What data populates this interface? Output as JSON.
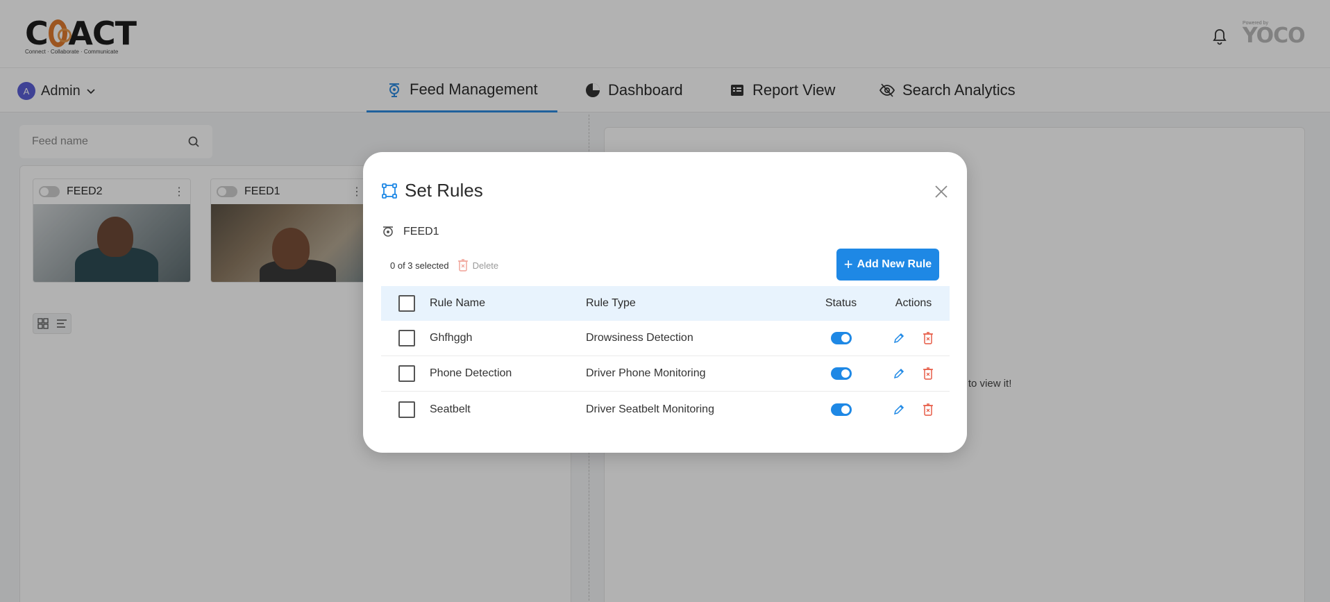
{
  "header": {
    "logo_text_left": "C",
    "logo_text_right": "ACT",
    "logo_tagline": "Connect · Collaborate · Communicate",
    "powered_by": "Powered by",
    "powered_brand": "YOCO"
  },
  "nav": {
    "user_initial": "A",
    "user_name": "Admin",
    "tabs": [
      {
        "label": "Feed Management",
        "icon": "camera-icon",
        "active": true
      },
      {
        "label": "Dashboard",
        "icon": "pie-chart-icon",
        "active": false
      },
      {
        "label": "Report View",
        "icon": "report-icon",
        "active": false
      },
      {
        "label": "Search Analytics",
        "icon": "eye-search-icon",
        "active": false
      }
    ]
  },
  "feeds": {
    "search_placeholder": "Feed name",
    "items": [
      {
        "name": "FEED2"
      },
      {
        "name": "FEED1"
      }
    ],
    "right_message_fragment": "ed to view it!"
  },
  "modal": {
    "title": "Set Rules",
    "feed_name": "FEED1",
    "selection_text": "0 of 3 selected",
    "delete_label": "Delete",
    "add_button_label": "Add New Rule",
    "columns": {
      "name": "Rule Name",
      "type": "Rule Type",
      "status": "Status",
      "actions": "Actions"
    },
    "rules": [
      {
        "name": "Ghfhggh",
        "type": "Drowsiness Detection",
        "enabled": true
      },
      {
        "name": "Phone Detection",
        "type": "Driver Phone Monitoring",
        "enabled": true
      },
      {
        "name": "Seatbelt",
        "type": "Driver Seatbelt Monitoring",
        "enabled": true
      }
    ]
  },
  "colors": {
    "accent": "#1e88e5",
    "danger": "#e5533d",
    "brand_orange": "#e07a2e",
    "table_header_bg": "#e8f3fd"
  }
}
